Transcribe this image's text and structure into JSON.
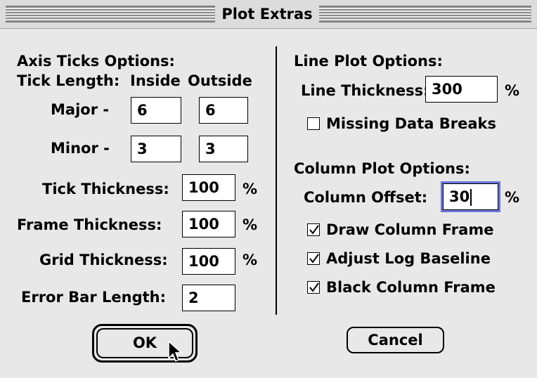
{
  "window": {
    "title": "Plot Extras"
  },
  "axis_ticks": {
    "heading": "Axis Ticks Options:",
    "tick_length_label": "Tick Length:",
    "inside_header": "Inside",
    "outside_header": "Outside",
    "major_label": "Major -",
    "minor_label": "Minor -",
    "major_inside": "6",
    "major_outside": "6",
    "minor_inside": "3",
    "minor_outside": "3",
    "tick_thickness_label": "Tick Thickness:",
    "tick_thickness": "100",
    "frame_thickness_label": "Frame Thickness:",
    "frame_thickness": "100",
    "grid_thickness_label": "Grid Thickness:",
    "grid_thickness": "100",
    "error_bar_label": "Error Bar Length:",
    "error_bar_length": "2",
    "percent": "%"
  },
  "line_plot": {
    "heading": "Line Plot Options:",
    "line_thickness_label": "Line Thickness:",
    "line_thickness": "300",
    "missing_breaks_label": "Missing Data Breaks",
    "missing_breaks_checked": false
  },
  "column_plot": {
    "heading": "Column Plot Options:",
    "column_offset_label": "Column Offset:",
    "column_offset": "30",
    "draw_frame_label": "Draw Column Frame",
    "draw_frame_checked": true,
    "adjust_log_label": "Adjust Log Baseline",
    "adjust_log_checked": true,
    "black_frame_label": "Black Column Frame",
    "black_frame_checked": true
  },
  "buttons": {
    "ok": "OK",
    "cancel": "Cancel"
  }
}
